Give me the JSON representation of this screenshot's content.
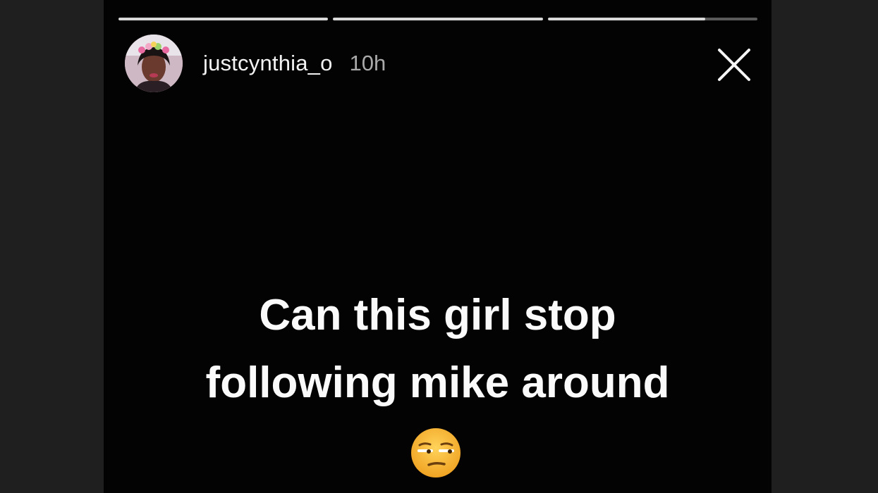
{
  "story": {
    "username": "justcynthia_o",
    "timestamp": "10h",
    "progress": [
      1.0,
      1.0,
      0.75
    ],
    "caption_lines": [
      "Can this girl stop",
      "following mike around"
    ],
    "emoji": "unamused-face-emoji"
  },
  "icons": {
    "close": "close-icon",
    "avatar": "profile-avatar"
  },
  "colors": {
    "story_background": "#030303",
    "outer_background": "#1f1f1f",
    "text": "#fafafa",
    "timestamp": "#a9a9a9",
    "emoji_face": "#f6b93a"
  }
}
